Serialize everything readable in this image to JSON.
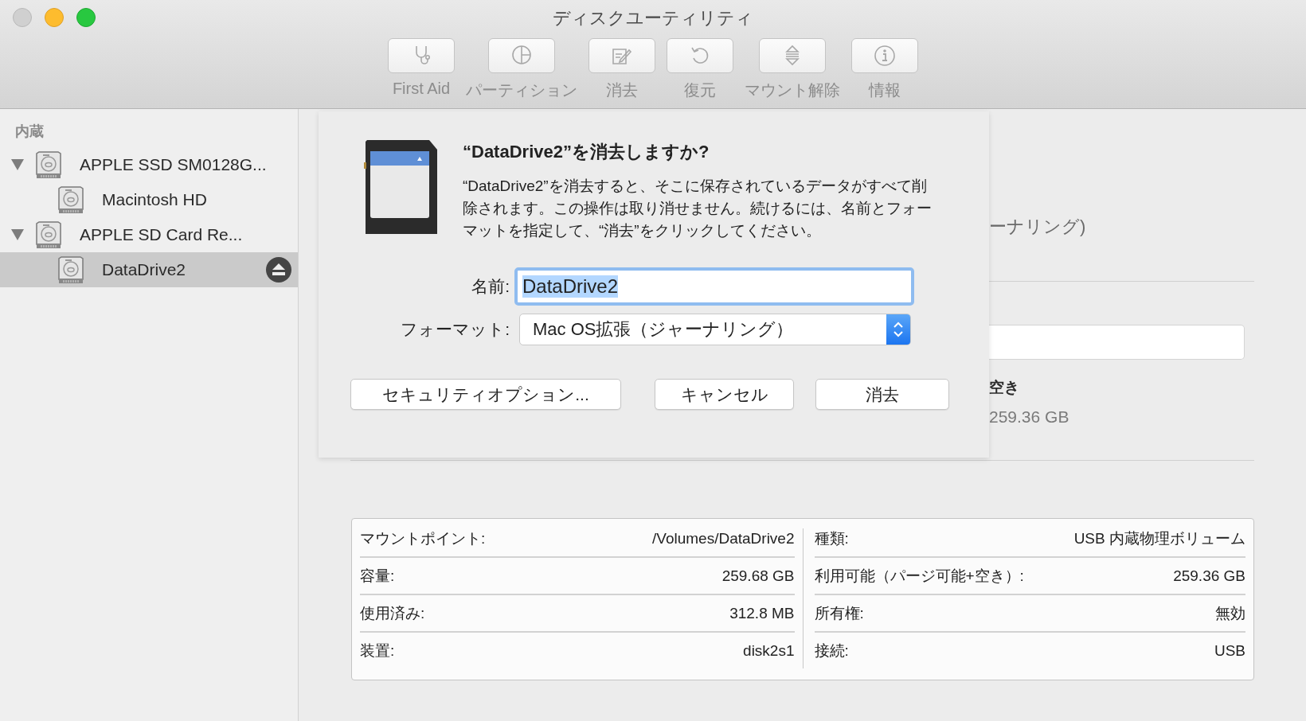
{
  "window": {
    "title": "ディスクユーティリティ"
  },
  "toolbar": [
    {
      "label": "First Aid",
      "kind": "first-aid",
      "disabled": true
    },
    {
      "label": "パーティション",
      "kind": "partition",
      "disabled": true
    },
    {
      "label": "消去",
      "kind": "erase",
      "disabled": true
    },
    {
      "label": "復元",
      "kind": "restore",
      "disabled": true
    },
    {
      "label": "マウント解除",
      "kind": "unmount",
      "disabled": true
    },
    {
      "label": "情報",
      "kind": "info",
      "disabled": true
    }
  ],
  "sidebar": {
    "section": "内蔵",
    "items": [
      {
        "name": "APPLE SSD SM0128G...",
        "expanded": true,
        "selected": false,
        "ejectable": false,
        "children": [
          {
            "name": "Macintosh HD",
            "selected": false,
            "ejectable": false
          }
        ]
      },
      {
        "name": "APPLE SD Card Re...",
        "expanded": true,
        "selected": false,
        "ejectable": false,
        "children": [
          {
            "name": "DataDrive2",
            "selected": true,
            "ejectable": true
          }
        ]
      }
    ]
  },
  "background": {
    "format_fragment": "ーナリング)",
    "free_label_fragment": "空き",
    "free_value_fragment": "259.36 GB"
  },
  "sheet": {
    "title": "“DataDrive2”を消去しますか?",
    "message": "“DataDrive2”を消去すると、そこに保存されているデータがすべて削除されます。この操作は取り消せません。続けるには、名前とフォーマットを指定して、“消去”をクリックしてください。",
    "name_label": "名前:",
    "name_value": "DataDrive2",
    "name_text_selected": true,
    "format_label": "フォーマット:",
    "format_value": "Mac OS拡張（ジャーナリング）",
    "buttons": [
      {
        "label": "セキュリティオプション..."
      },
      {
        "label": "キャンセル"
      },
      {
        "label": "消去"
      }
    ]
  },
  "info_table": {
    "left": [
      {
        "label": "マウントポイント:",
        "value": "/Volumes/DataDrive2"
      },
      {
        "label": "容量:",
        "value": "259.68 GB"
      },
      {
        "label": "使用済み:",
        "value": "312.8 MB"
      },
      {
        "label": "装置:",
        "value": "disk2s1"
      }
    ],
    "right": [
      {
        "label": "種類:",
        "value": "USB 内蔵物理ボリューム"
      },
      {
        "label": "利用可能（パージ可能+空き）:",
        "value": "259.36 GB"
      },
      {
        "label": "所有権:",
        "value": "無効"
      },
      {
        "label": "接続:",
        "value": "USB"
      }
    ]
  }
}
